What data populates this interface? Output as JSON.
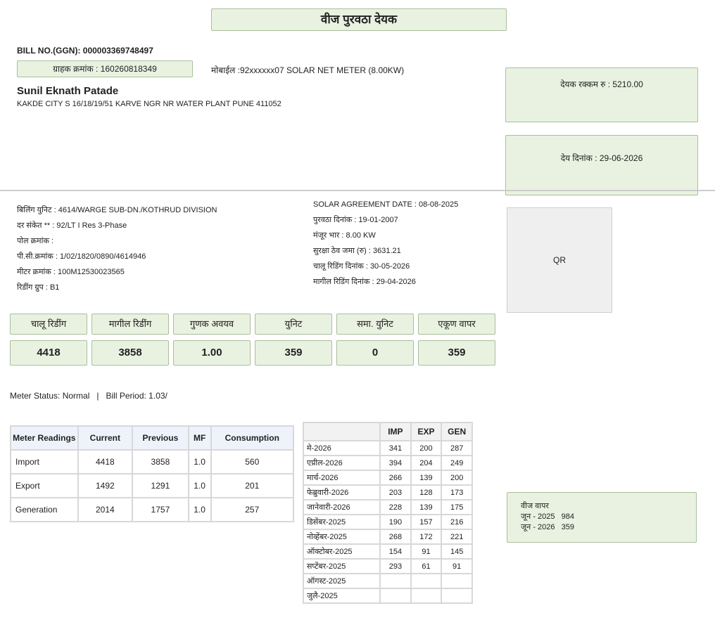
{
  "header": {
    "title": "वीज पुरवठा देयक"
  },
  "bill": {
    "bill_no": "BILL NO.(GGN): 000003369748497",
    "consumer_no": "ग्राहक क्रमांक : 160260818349",
    "mobile": "मोबाईल :92xxxxxx07   SOLAR NET METER (8.00KW)",
    "name": "Sunil Eknath Patade",
    "address": "KAKDE CITY S 16/18/19/51 KARVE NGR NR WATER PLANT PUNE 411052",
    "amount": "देयक रक्कम रु : 5210.00",
    "due_date": "देय दिनांक : 29-06-2026"
  },
  "left_info": [
    "बिलिंग युनिट : 4614/WARGE SUB-DN./KOTHRUD DIVISION",
    "दर संकेत ** : 92/LT I Res 3-Phase",
    "पोल क्रमांक :",
    "पी.सी.क्रमांक : 1/02/1820/0890/4614946",
    "मीटर क्रमांक : 100M12530023565",
    "रिडींग ग्रुप : B1"
  ],
  "right_info": [
    "SOLAR AGREEMENT DATE : 08-08-2025",
    "पुरवठा दिनांक : 19-01-2007",
    "मंजूर भार : 8.00 KW",
    "सुरक्षा ठेव जमा (रु) : 3631.21",
    "चालू रिडिंग दिनांक : 30-05-2026",
    "मागील रिडिंग दिनांक : 29-04-2026"
  ],
  "qr": {
    "label": "QR"
  },
  "readings": {
    "labels": [
      "चालू रिडींग",
      "मागील रिडींग",
      "गुणक अवयव",
      "युनिट",
      "समा. युनिट",
      "एकूण वापर"
    ],
    "values": [
      "4418",
      "3858",
      "1.00",
      "359",
      "0",
      "359"
    ]
  },
  "status": {
    "text": "Meter Status: Normal   |   Bill Period: 1.03/"
  },
  "meter_table": {
    "headers": [
      "Meter Readings",
      "Current",
      "Previous",
      "MF",
      "Consumption"
    ],
    "rows": [
      [
        "Import",
        "4418",
        "3858",
        "1.0",
        "560"
      ],
      [
        "Export",
        "1492",
        "1291",
        "1.0",
        "201"
      ],
      [
        "Generation",
        "2014",
        "1757",
        "1.0",
        "257"
      ]
    ]
  },
  "history_table": {
    "headers": [
      "",
      "IMP",
      "EXP",
      "GEN"
    ],
    "rows": [
      [
        "मे-2026",
        "341",
        "200",
        "287"
      ],
      [
        "एप्रील-2026",
        "394",
        "204",
        "249"
      ],
      [
        "मार्च-2026",
        "266",
        "139",
        "200"
      ],
      [
        "फेब्रुवारी-2026",
        "203",
        "128",
        "173"
      ],
      [
        "जानेवारी-2026",
        "228",
        "139",
        "175"
      ],
      [
        "डिसेंबर-2025",
        "190",
        "157",
        "216"
      ],
      [
        "नोव्हेंबर-2025",
        "268",
        "172",
        "221"
      ],
      [
        "ऑक्टोबर-2025",
        "154",
        "91",
        "145"
      ],
      [
        "सप्टेंबर-2025",
        "293",
        "61",
        "91"
      ],
      [
        "ऑगस्ट-2025",
        "",
        "",
        ""
      ],
      [
        "जुलै-2025",
        "",
        "",
        ""
      ]
    ]
  },
  "usage": {
    "title": "वीज वापर",
    "rows": [
      "जून - 2025   984",
      "जून - 2026   359"
    ]
  }
}
